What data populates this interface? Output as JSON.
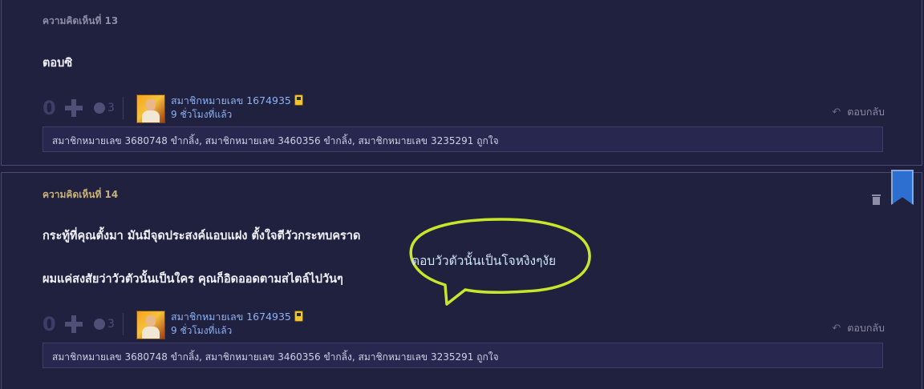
{
  "comments": [
    {
      "header": "ความคิดเห็นที่ 13",
      "body_lines": [
        "ตอบซิ"
      ],
      "vote_count": "0",
      "emotion_count": "3",
      "username": "สมาชิกหมายเลข 1674935",
      "time": "9 ชั่วโมงที่แล้ว",
      "reply_label": "ตอบกลับ",
      "likes": "สมาชิกหมายเลข 3680748 ขำกลิ้ง, สมาชิกหมายเลข 3460356 ขำกลิ้ง, สมาชิกหมายเลข 3235291 ถูกใจ"
    },
    {
      "header": "ความคิดเห็นที่ 14",
      "body_lines": [
        "กระทู้ที่คุณตั้งมา  มันมีจุดประสงค์แอบแฝง  ตั้งใจตีวัวกระทบคราด",
        "ผมแค่สงสัยว่าวัวตัวนั้นเป็นใคร  คุณก็อิดออดตามสไตล์ไปวันๆ"
      ],
      "vote_count": "0",
      "emotion_count": "3",
      "username": "สมาชิกหมายเลข 1674935",
      "time": "9 ชั่วโมงที่แล้ว",
      "reply_label": "ตอบกลับ",
      "likes": "สมาชิกหมายเลข 3680748 ขำกลิ้ง, สมาชิกหมายเลข 3460356 ขำกลิ้ง, สมาชิกหมายเลข 3235291 ถูกใจ"
    }
  ],
  "annotation": {
    "text": "ตอบวัวตัวนั้นเป็นโจหงิงๆงัย",
    "color": "#c8e62a"
  },
  "icons": {
    "plus": "plus-icon",
    "emotion": "emotion-icon",
    "badge": "member-badge-icon",
    "reply": "reply-arrow-icon",
    "trash": "trash-icon",
    "bookmark": "bookmark-icon"
  }
}
